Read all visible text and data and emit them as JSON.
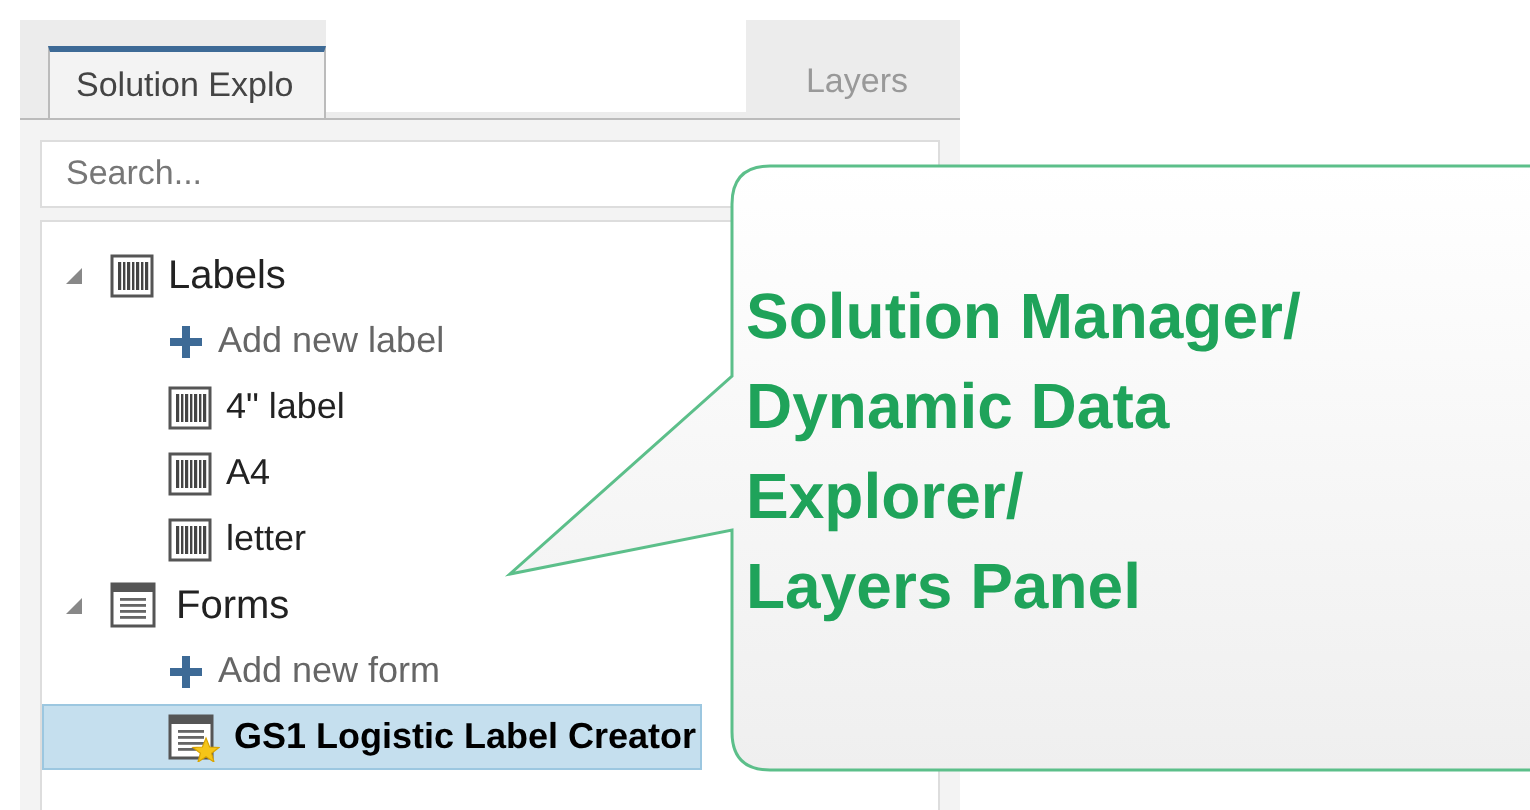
{
  "tabs": [
    {
      "label": "Solution Explo",
      "selected": true
    },
    {
      "label": "Layers",
      "selected": false
    }
  ],
  "search": {
    "placeholder": "Search..."
  },
  "tree": [
    {
      "kind": "labelgroup",
      "label": "Labels",
      "expanded": true,
      "selected": false,
      "children": [
        {
          "kind": "add",
          "label": "Add new label",
          "selected": false
        },
        {
          "kind": "label",
          "label": "4\" label",
          "selected": false
        },
        {
          "kind": "label",
          "label": "A4",
          "selected": false
        },
        {
          "kind": "label",
          "label": "letter",
          "selected": false
        }
      ]
    },
    {
      "kind": "formgroup",
      "label": "Forms",
      "expanded": true,
      "selected": false,
      "children": [
        {
          "kind": "add",
          "label": "Add new form",
          "selected": false
        },
        {
          "kind": "form",
          "label": "GS1 Logistic Label Creator",
          "selected": true
        }
      ]
    }
  ],
  "callout": {
    "lines": [
      "Solution Manager/",
      "Dynamic Data",
      "Explorer/",
      "Layers Panel"
    ]
  }
}
